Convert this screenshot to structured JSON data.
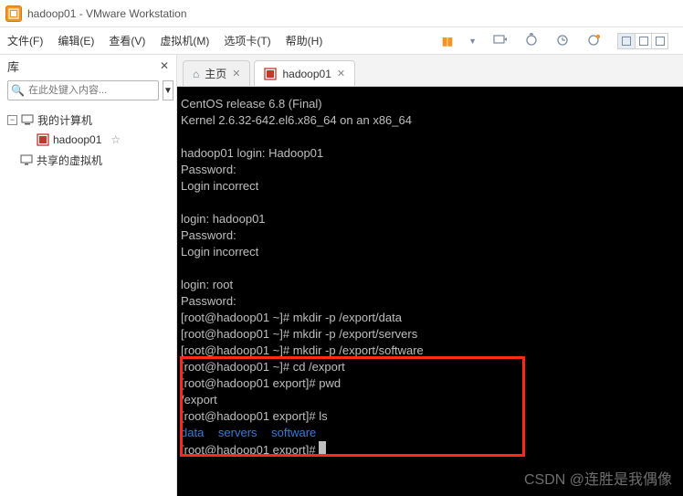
{
  "titlebar": {
    "text": "hadoop01 - VMware Workstation"
  },
  "menu": {
    "file": "文件(F)",
    "edit": "编辑(E)",
    "view": "查看(V)",
    "vm": "虚拟机(M)",
    "tabs": "选项卡(T)",
    "help": "帮助(H)"
  },
  "library": {
    "title": "库",
    "search_placeholder": "在此处键入内容...",
    "my_computer": "我的计算机",
    "vm_hadoop01": "hadoop01",
    "shared_vms": "共享的虚拟机"
  },
  "tabs": {
    "home": "主页",
    "vm": "hadoop01"
  },
  "terminal": {
    "l1": "CentOS release 6.8 (Final)",
    "l2": "Kernel 2.6.32-642.el6.x86_64 on an x86_64",
    "l3": "",
    "l4": "hadoop01 login: Hadoop01",
    "l5": "Password:",
    "l6": "Login incorrect",
    "l7": "",
    "l8": "login: hadoop01",
    "l9": "Password:",
    "l10": "Login incorrect",
    "l11": "",
    "l12": "login: root",
    "l13": "Password:",
    "l14": "[root@hadoop01 ~]# mkdir -p /export/data",
    "l15": "[root@hadoop01 ~]# mkdir -p /export/servers",
    "l16": "[root@hadoop01 ~]# mkdir -p /export/software",
    "l17": "[root@hadoop01 ~]# cd /export",
    "l18": "[root@hadoop01 export]# pwd",
    "l19": "/export",
    "l20": "[root@hadoop01 export]# ls",
    "l21a": "data",
    "l21b": "servers",
    "l21c": "software",
    "l22": "[root@hadoop01 export]# "
  },
  "watermark": "CSDN @连胜是我偶像"
}
